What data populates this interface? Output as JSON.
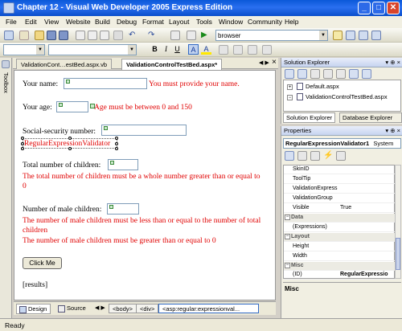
{
  "window": {
    "title": "Chapter 12 - Visual Web Developer 2005 Express Edition",
    "minimize_label": "_",
    "maximize_label": "□",
    "close_label": "✕"
  },
  "menu": {
    "items": [
      "File",
      "Edit",
      "View",
      "Website",
      "Build",
      "Debug",
      "Format",
      "Layout",
      "Tools",
      "Window",
      "Community",
      "Help"
    ]
  },
  "toolbar": {
    "browser_target": "browser",
    "bold_label": "B",
    "italic_label": "I",
    "underline_label": "U",
    "font_color_label": "A",
    "highlight_label": "A"
  },
  "toolbox": {
    "label": "Toolbox"
  },
  "doc_tabs": [
    {
      "label": "ValidationCont…estBed.aspx.vb",
      "active": false
    },
    {
      "label": "ValidationControlTestBed.aspx*",
      "active": true
    }
  ],
  "doc_tabs_close": "×",
  "design": {
    "name_label": "Your name:",
    "name_error": "You must provide your name.",
    "age_label": "Your age:",
    "age_error": "Age must be between 0 and 150",
    "ssn_label": "Social-security number:",
    "ssn_validator": "RegularExpressionValidator",
    "children_label": "Total number of children:",
    "children_error": "The total number of children must be a whole number greater than or equal to 0",
    "male_label": "Number of male children:",
    "male_error_1": "The number of male children must be less than or equal to the number of total children",
    "male_error_2": "The number of male children must be greater than or equal to 0",
    "button_label": "Click Me",
    "results_label": "[results]"
  },
  "bottom": {
    "design_tab": "Design",
    "source_tab": "Source",
    "crumbs": [
      "<body>",
      "<div>",
      "<asp:regular:expressionval..."
    ]
  },
  "solution_explorer": {
    "title": "Solution Explorer",
    "pin": "▾ ⊕ ×",
    "files": [
      "Default.aspx",
      "ValidationControlTestBed.aspx"
    ],
    "tab_solution": "Solution Explorer",
    "tab_database": "Database Explorer"
  },
  "properties": {
    "title": "Properties",
    "pin": "▾ ⊕ ×",
    "object": "RegularExpressionValidator1",
    "object_type": "System",
    "rows": [
      {
        "name": "SkinID",
        "value": "",
        "category": false
      },
      {
        "name": "ToolTip",
        "value": "",
        "category": false
      },
      {
        "name": "ValidationExpress",
        "value": "",
        "category": false
      },
      {
        "name": "ValidationGroup",
        "value": "",
        "category": false
      },
      {
        "name": "Visible",
        "value": "True",
        "category": false
      },
      {
        "name": "Data",
        "value": "",
        "category": true
      },
      {
        "name": "(Expressions)",
        "value": "",
        "category": false
      },
      {
        "name": "Layout",
        "value": "",
        "category": true
      },
      {
        "name": "Height",
        "value": "",
        "category": false
      },
      {
        "name": "Width",
        "value": "",
        "category": false
      },
      {
        "name": "Misc",
        "value": "",
        "category": true
      },
      {
        "name": "(ID)",
        "value": "RegularExpressio",
        "category": false
      }
    ],
    "description_title": "Misc"
  },
  "status": {
    "text": "Ready"
  }
}
